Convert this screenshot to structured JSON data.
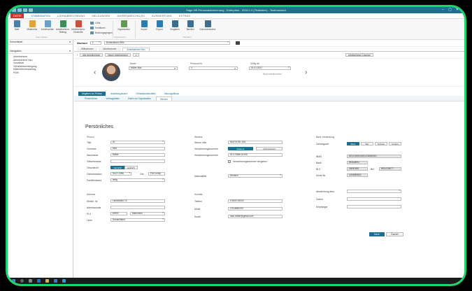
{
  "window": {
    "title": "Sage HR Personalabrechnung - Enterprise - 2018.1.0 (Testdaten) - Testmandant"
  },
  "ribbon_tabs": [
    "Datei",
    "Stammdaten",
    "Lohnabrechnung",
    "Meldungen",
    "Jahresabschluss",
    "Auswertung",
    "Extras"
  ],
  "ribbon": {
    "buttons_left": [
      "Start",
      "Mitarbeiter",
      "Arbeitszeiten",
      "Arbeitnehmer-Beitrag",
      "Arbeitnehmer-Einkünfte"
    ],
    "group_left_label": "Stammdaten",
    "small_items": [
      "CRM",
      "Kreditoren",
      "Buchungsgruppen"
    ],
    "group_mid_label": "Organisation",
    "org_button": "Organisation",
    "import_buttons": [
      "Import",
      "Export",
      "Vorgaben",
      "Tabellen",
      "Dokumentarchiv"
    ],
    "group_right_label": "Vorhalten"
  },
  "left": {
    "schnellstart": "Schnellstart",
    "navigation": "Navigation",
    "items": [
      "Arbeitnehmer",
      "Arbeitnehmer Neu",
      "Vorstände",
      "Gehaltsbescheinigung",
      "Mitarbeiterverwaltung",
      "Profil"
    ]
  },
  "main": {
    "mandant_label": "Mandant",
    "mandant_value": "1",
    "mandant_name": "Deutschland 1994",
    "doc_tabs": [
      "Willkommen",
      "Arbeitnehmer",
      "Arbeitnehmer Neu"
    ],
    "toolbar": {
      "all_employees": "Alle Arbeitnehmer",
      "new_employee": "Neuer Arbeitnehmer",
      "delete_employee": "Arbeitnehmer Löschen"
    },
    "employee": {
      "name_label": "Name",
      "name_value": "Müller Max",
      "persnr_label": "Personal Nr.",
      "persnr_value": "4",
      "date_label": "Gültig ab",
      "date_value": "01.01.2017",
      "status": "Nicht Arbeitnehmer"
    },
    "form_tabs": [
      "Angaben zur Person",
      "Anstellungsdaten",
      "Gehaltsbestandteile",
      "Zahlungsflüsse"
    ],
    "sub_tabs": [
      "Persönliches",
      "Vertragsdaten",
      "Daten zur Organisation",
      "Steuern"
    ],
    "form": {
      "title": "Persönliches",
      "person_section": "Person",
      "fields_person": [
        {
          "label": "Titel",
          "value": "Dr."
        },
        {
          "label": "Vorname",
          "value": "Max"
        },
        {
          "label": "Nachname",
          "value": "Müller"
        },
        {
          "label": "Geburtsname",
          "value": ""
        }
      ],
      "geschlecht_label": "Geschlecht",
      "geschlecht_options": [
        "männlich",
        "weiblich"
      ],
      "geburtsdatum_label": "Geburtsdatum",
      "geburtsdatum_value": "05.07.1996",
      "geburtsort_label": "Ohr.",
      "geburtsort_value": "Frei Lenky",
      "familienstand_label": "Familienstand",
      "familienstand_value": "ledig",
      "address_section": "Adresse",
      "strasse_label": "Straße, Nr.",
      "strasse_value": "Landstraße 10",
      "zusatz_label": "Adresszusatz",
      "zusatz_value": "",
      "plz_label": "PLZ",
      "plz_value": "60000",
      "ort_value": "Mannheim",
      "land_label": "Land",
      "land_value": "Deutschland",
      "middle_section": "Weitere",
      "steuer_label": "Steuer IdNr.",
      "steuer_value": "98 876 531 003",
      "vers_label": "Versicherungsnummer",
      "vers_status_on": "bekannt",
      "vers_status_off": "nicht bekannt",
      "versnr_label": "Versicherungsnummer",
      "versnr_value": "91 070696 M 005",
      "checkbox_label": "Versicherungsnummer vergeben",
      "nation_label": "Nationalität",
      "nation_value": "Deutsch",
      "kontakt_section": "Kontakt",
      "telefon_label": "Telefon",
      "telefon_value": "0 6000 00000",
      "mobil_label": "Mobil",
      "mobil_value": "176 8850193",
      "email_label": "Email",
      "email_value": "max.müller@gmail.com",
      "bank_section": "Bank Verbindung",
      "zahlungsart_label": "Zahlungsart",
      "zahlungsart_options": [
        "Bank",
        "Bar",
        "Scheck",
        "Andere"
      ],
      "iban_label": "IBAN",
      "iban_value": "DE12300514001234560001",
      "bank_label": "Bank",
      "bank_value": "WOLIBRu",
      "blz_label": "BLZ",
      "blz_value": "30051500",
      "bic_label": "BIC",
      "bic_value": "WOLGDE77",
      "kontonr_label": "Konto Nr.",
      "kontonr_value": "1234560001",
      "abw_label": "Abweichung abst",
      "zweck_label": "Zweck",
      "empf_label": "Empfänger",
      "save_label": "Save",
      "cancel_label": "Cancel"
    }
  },
  "colors": {
    "accent": "#1d6f91",
    "file_tab": "#d4312f",
    "frame": "#1fd36b"
  }
}
